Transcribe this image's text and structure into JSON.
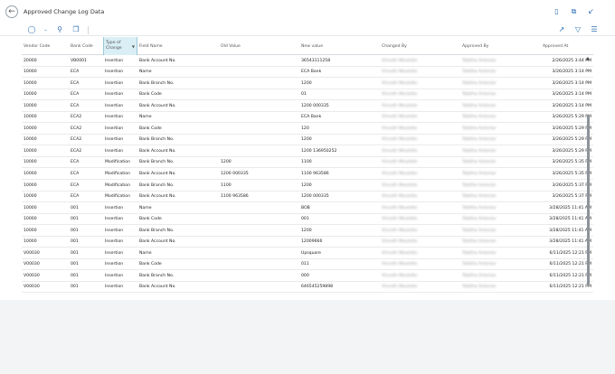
{
  "window": {
    "title": "Approved Change Log Data"
  },
  "icons": {
    "back": "arrow-left-icon",
    "bookmark": "bookmark-icon",
    "open_new": "open-new-window-icon",
    "collapse": "collapse-icon",
    "filter_view": "filter-view-icon",
    "search": "search-icon",
    "copy": "copy-icon",
    "share": "share-icon",
    "filter": "filter-icon",
    "list": "list-icon"
  },
  "columns": [
    {
      "label": "Vendor Code"
    },
    {
      "label": "Bank Code"
    },
    {
      "label": "Type of Change"
    },
    {
      "label": "Field Name"
    },
    {
      "label": "Old Value"
    },
    {
      "label": "New value"
    },
    {
      "label": "Changed By"
    },
    {
      "label": "Approved By"
    },
    {
      "label": "Approved At"
    }
  ],
  "rows": [
    {
      "vendor": "20000",
      "bank": "VB0001",
      "type": "Insertion",
      "field": "Bank Account No.",
      "old": "",
      "new": "36543111258",
      "changed_by": "Vinceth Woulette",
      "approved_by": "Tabitha Antoniar",
      "approved_at": "2/26/2025 3:44 PM"
    },
    {
      "vendor": "10000",
      "bank": "ECA",
      "type": "Insertion",
      "field": "Name",
      "old": "",
      "new": "ECA Bank",
      "changed_by": "Vinceth Woulette",
      "approved_by": "Tabitha Antoniar",
      "approved_at": "3/26/2025 3:14 PM"
    },
    {
      "vendor": "10000",
      "bank": "ECA",
      "type": "Insertion",
      "field": "Bank Branch No.",
      "old": "",
      "new": "1200",
      "changed_by": "Vinceth Woulette",
      "approved_by": "Tabitha Antoniar",
      "approved_at": "3/26/2025 3:14 PM"
    },
    {
      "vendor": "10000",
      "bank": "ECA",
      "type": "Insertion",
      "field": "Bank Code",
      "old": "",
      "new": "01",
      "changed_by": "Vinceth Woulette",
      "approved_by": "Tabitha Antoniar",
      "approved_at": "3/26/2025 3:14 PM"
    },
    {
      "vendor": "10000",
      "bank": "ECA",
      "type": "Insertion",
      "field": "Bank Account No.",
      "old": "",
      "new": "1200 000335",
      "changed_by": "Vinceth Woulette",
      "approved_by": "Tabitha Antoniar",
      "approved_at": "3/26/2025 3:14 PM"
    },
    {
      "vendor": "10000",
      "bank": "ECA2",
      "type": "Insertion",
      "field": "Name",
      "old": "",
      "new": "ECA Bank",
      "changed_by": "Vinceth Woulette",
      "approved_by": "Tabitha Antoniar",
      "approved_at": "3/26/2025 5:29 PM"
    },
    {
      "vendor": "10000",
      "bank": "ECA2",
      "type": "Insertion",
      "field": "Bank Code",
      "old": "",
      "new": "120",
      "changed_by": "Vinceth Woulette",
      "approved_by": "Tabitha Antoniar",
      "approved_at": "3/26/2025 5:29 PM"
    },
    {
      "vendor": "10000",
      "bank": "ECA2",
      "type": "Insertion",
      "field": "Bank Branch No.",
      "old": "",
      "new": "1200",
      "changed_by": "Vinceth Woulette",
      "approved_by": "Tabitha Antoniar",
      "approved_at": "3/26/2025 5:29 PM"
    },
    {
      "vendor": "10000",
      "bank": "ECA2",
      "type": "Insertion",
      "field": "Bank Account No.",
      "old": "",
      "new": "1200 136950252",
      "changed_by": "Vinceth Woulette",
      "approved_by": "Tabitha Antoniar",
      "approved_at": "3/26/2025 5:29 PM"
    },
    {
      "vendor": "10000",
      "bank": "ECA",
      "type": "Modification",
      "field": "Bank Branch No.",
      "old": "1200",
      "new": "1100",
      "changed_by": "Vinceth Woulette",
      "approved_by": "Tabitha Antoniar",
      "approved_at": "3/26/2025 5:35 PM"
    },
    {
      "vendor": "10000",
      "bank": "ECA",
      "type": "Modification",
      "field": "Bank Account No.",
      "old": "1200 000335",
      "new": "1100 963586",
      "changed_by": "Vinceth Woulette",
      "approved_by": "Tabitha Antoniar",
      "approved_at": "3/26/2025 5:35 PM"
    },
    {
      "vendor": "10000",
      "bank": "ECA",
      "type": "Modification",
      "field": "Bank Branch No.",
      "old": "1100",
      "new": "1200",
      "changed_by": "Vinceth Woulette",
      "approved_by": "Tabitha Antoniar",
      "approved_at": "3/26/2025 5:37 PM"
    },
    {
      "vendor": "10000",
      "bank": "ECA",
      "type": "Modification",
      "field": "Bank Account No.",
      "old": "1100 963586",
      "new": "1200 000335",
      "changed_by": "Vinceth Woulette",
      "approved_by": "Tabitha Antoniar",
      "approved_at": "3/26/2025 5:37 PM"
    },
    {
      "vendor": "10000",
      "bank": "001",
      "type": "Insertion",
      "field": "Name",
      "old": "",
      "new": "BOB",
      "changed_by": "Vinceth Woulette",
      "approved_by": "Tabitha Antoniar",
      "approved_at": "3/28/2025 11:41 AM"
    },
    {
      "vendor": "10000",
      "bank": "001",
      "type": "Insertion",
      "field": "Bank Code",
      "old": "",
      "new": "001",
      "changed_by": "Vinceth Woulette",
      "approved_by": "Tabitha Antoniar",
      "approved_at": "3/28/2025 11:41 AM"
    },
    {
      "vendor": "10000",
      "bank": "001",
      "type": "Insertion",
      "field": "Bank Branch No.",
      "old": "",
      "new": "1200",
      "changed_by": "Vinceth Woulette",
      "approved_by": "Tabitha Antoniar",
      "approved_at": "3/28/2025 11:41 AM"
    },
    {
      "vendor": "10000",
      "bank": "001",
      "type": "Insertion",
      "field": "Bank Account No.",
      "old": "",
      "new": "12009666",
      "changed_by": "Vinceth Woulette",
      "approved_by": "Tabitha Antoniar",
      "approved_at": "3/28/2025 11:41 AM"
    },
    {
      "vendor": "V00030",
      "bank": "001",
      "type": "Insertion",
      "field": "Name",
      "old": "",
      "new": "Upsquare",
      "changed_by": "Vinceth Woulette",
      "approved_by": "Tabitha Antoniar",
      "approved_at": "6/11/2025 12:21 PM"
    },
    {
      "vendor": "V00030",
      "bank": "001",
      "type": "Insertion",
      "field": "Bank Code",
      "old": "",
      "new": "011",
      "changed_by": "Vinceth Woulette",
      "approved_by": "Tabitha Antoniar",
      "approved_at": "6/11/2025 12:21 PM"
    },
    {
      "vendor": "V00030",
      "bank": "001",
      "type": "Insertion",
      "field": "Bank Branch No.",
      "old": "",
      "new": "000",
      "changed_by": "Vinceth Woulette",
      "approved_by": "Tabitha Antoniar",
      "approved_at": "6/11/2025 12:21 PM"
    },
    {
      "vendor": "V00030",
      "bank": "001",
      "type": "Insertion",
      "field": "Bank Account No.",
      "old": "",
      "new": "646545259898",
      "changed_by": "Vinceth Woulette",
      "approved_by": "Tabitha Antoniar",
      "approved_at": "6/11/2025 12:21 PM"
    }
  ]
}
